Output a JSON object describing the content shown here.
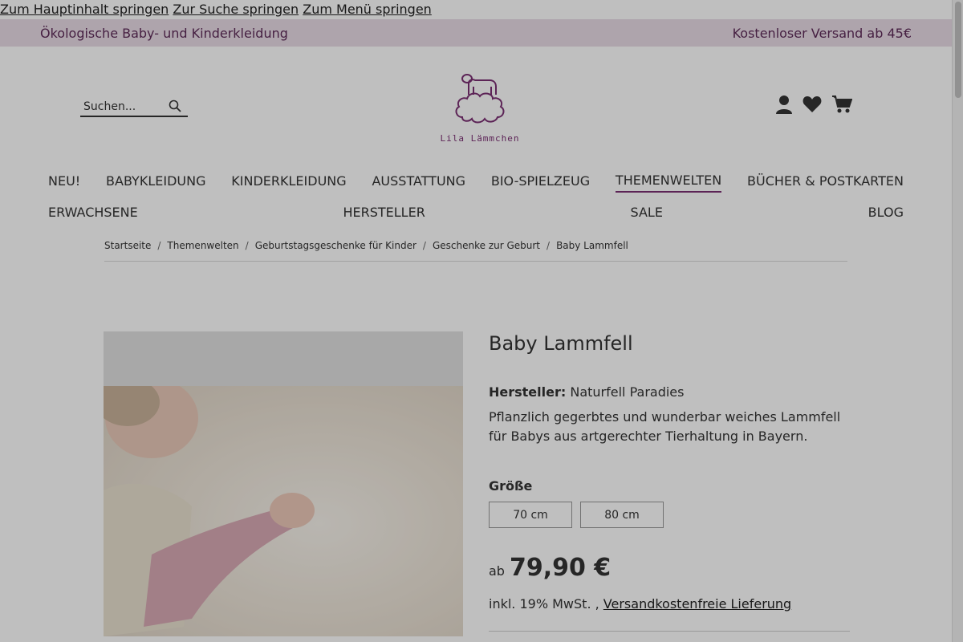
{
  "skip_links": [
    "Zum Hauptinhalt springen",
    "Zur Suche springen",
    "Zum Menü springen"
  ],
  "topbar": {
    "left": "Ökologische Baby- und Kinderkleidung",
    "right": "Kostenloser Versand ab 45€"
  },
  "search": {
    "placeholder": "Suchen..."
  },
  "logo": {
    "name": "Lila Lämmchen"
  },
  "nav": {
    "row1": [
      "NEU!",
      "BABYKLEIDUNG",
      "KINDERKLEIDUNG",
      "AUSSTATTUNG",
      "BIO-SPIELZEUG",
      "THEMENWELTEN",
      "BÜCHER & POSTKARTEN"
    ],
    "row2": [
      "ERWACHSENE",
      "HERSTELLER",
      "SALE",
      "BLOG"
    ]
  },
  "breadcrumb": [
    "Startseite",
    "Themenwelten",
    "Geburtstagsgeschenke für Kinder",
    "Geschenke zur Geburt",
    "Baby Lammfell"
  ],
  "product": {
    "title": "Baby Lammfell",
    "maker_label": "Hersteller:",
    "maker": "Naturfell Paradies",
    "description": "Pflanzlich gegerbtes und wunderbar weiches Lammfell für Babys aus artgerechter Tierhaltung in Bayern.",
    "size_label": "Größe",
    "sizes": [
      "70 cm",
      "80 cm"
    ],
    "price_prefix": "ab",
    "price": "79,90 €",
    "tax_text": "inkl. 19% MwSt. ,",
    "shipping_link": "Versandkostenfreie Lieferung"
  },
  "colors": {
    "brand": "#7b2f73",
    "topbar_bg": "#e8dbe6"
  }
}
